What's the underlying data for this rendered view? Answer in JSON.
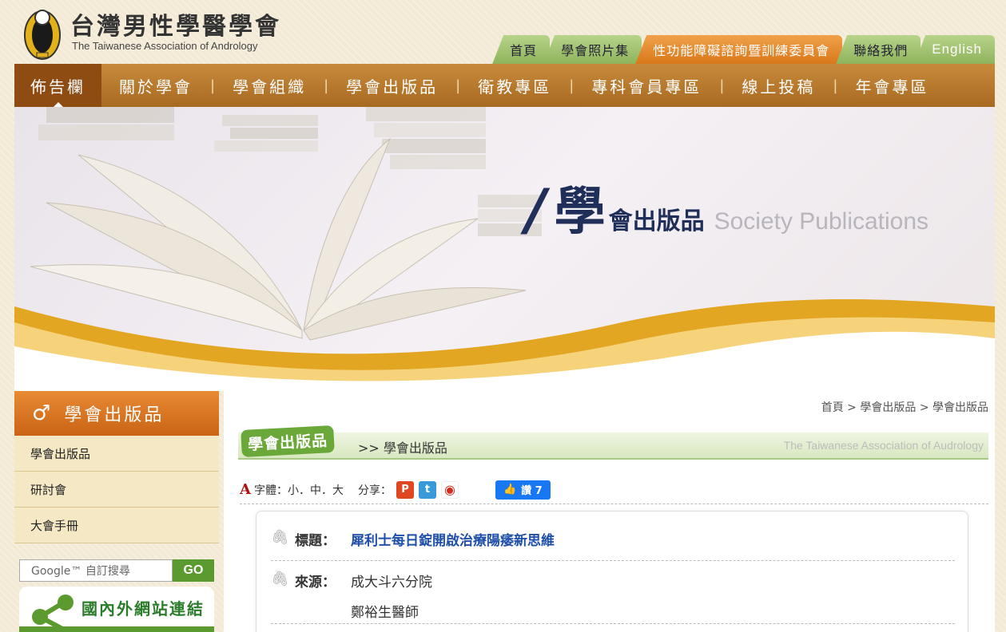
{
  "header": {
    "title_cn": "台灣男性學醫學會",
    "title_en": "The Taiwanese Association of Andrology",
    "top_tabs": [
      {
        "label": "首頁"
      },
      {
        "label": "學會照片集"
      },
      {
        "label": "性功能障礙諮詢暨訓練委員會"
      },
      {
        "label": "聯絡我們"
      },
      {
        "label": "English"
      }
    ]
  },
  "main_nav": [
    {
      "label": "佈告欄"
    },
    {
      "label": "關於學會"
    },
    {
      "label": "學會組織"
    },
    {
      "label": "學會出版品"
    },
    {
      "label": "衛教專區"
    },
    {
      "label": "專科會員專區"
    },
    {
      "label": "線上投稿"
    },
    {
      "label": "年會專區"
    }
  ],
  "banner": {
    "slash": "/",
    "big_char": "學",
    "rest": "會出版品",
    "en": "Society Publications"
  },
  "sidebar": {
    "title": "學會出版品",
    "icon": "♂",
    "items": [
      {
        "label": "學會出版品"
      },
      {
        "label": "研討會"
      },
      {
        "label": "大會手冊"
      }
    ],
    "search_placeholder": "Google™ 自訂搜尋",
    "search_go": "GO",
    "links_title": "國內外網站連結"
  },
  "content": {
    "breadcrumb": "首頁 > 學會出版品 > 學會出版品",
    "section_badge": "學會出版品",
    "section_path": ">> 學會出版品",
    "section_en": "The Taiwanese Association of Audrology",
    "tools": {
      "font_label": "字體：小．中．大",
      "share_label": "分享：",
      "like_label": "讚 7"
    },
    "article": {
      "title_label": "標題：",
      "title_value": "犀利士每日錠開啟治療陽痿新思維",
      "source_label": "來源：",
      "source_value": "成大斗六分院",
      "author": "鄭裕生醫師"
    }
  }
}
